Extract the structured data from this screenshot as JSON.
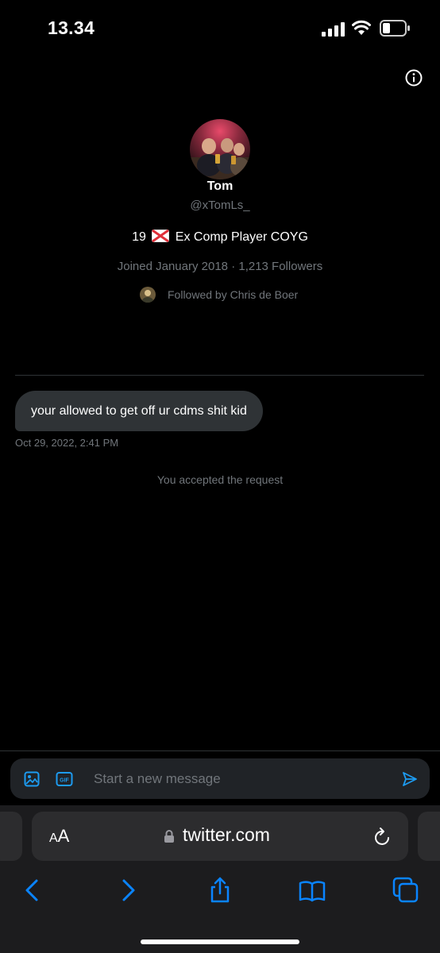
{
  "status_bar": {
    "time": "13.34",
    "icons": [
      "cellular-signal-icon",
      "wifi-icon",
      "battery-icon"
    ]
  },
  "header": {
    "info_icon": "info-icon"
  },
  "profile": {
    "name": "Tom",
    "handle": "@xTomLs_",
    "bio_prefix": "19",
    "bio_suffix": "Ex Comp Player COYG",
    "bio_flag_icon": "st-patrick-flag-icon",
    "meta": "Joined January 2018 · 1,213 Followers",
    "followed_by": "Followed by Chris de Boer"
  },
  "conversation": {
    "messages": [
      {
        "text": "your allowed to get off ur cdms shit kid",
        "timestamp": "Oct 29, 2022, 2:41 PM"
      }
    ],
    "system_note": "You accepted the request"
  },
  "composer": {
    "placeholder": "Start a new message",
    "icons": [
      "image-icon",
      "gif-icon",
      "send-icon"
    ]
  },
  "browser": {
    "text_size_label_small": "A",
    "text_size_label_large": "A",
    "url": "twitter.com",
    "toolbar": [
      "back-icon",
      "forward-icon",
      "share-icon",
      "bookmarks-icon",
      "tabs-icon"
    ]
  },
  "colors": {
    "background": "#000000",
    "accent": "#1d9bf0",
    "safari_accent": "#0a84ff",
    "muted_text": "#71767b",
    "bubble": "#2f3336"
  }
}
